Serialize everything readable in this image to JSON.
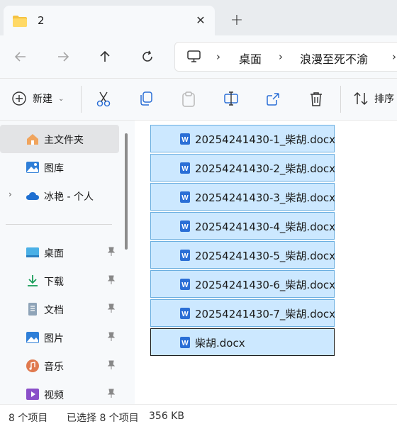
{
  "tab": {
    "title": "2",
    "icon": "folder-icon"
  },
  "address": {
    "icon": "this-pc-icon",
    "crumbs": [
      "桌面",
      "浪漫至死不渝"
    ]
  },
  "toolbar": {
    "new_label": "新建",
    "sort_label": "排序"
  },
  "sidebar": {
    "items": [
      {
        "label": "主文件夹",
        "icon": "home-icon",
        "selected": true
      },
      {
        "label": "图库",
        "icon": "gallery-icon"
      },
      {
        "label": "冰艳 - 个人",
        "icon": "onedrive-cloud-icon"
      },
      {
        "label": "桌面",
        "icon": "desktop-icon",
        "pinned": true
      },
      {
        "label": "下载",
        "icon": "download-icon",
        "pinned": true
      },
      {
        "label": "文档",
        "icon": "documents-icon",
        "pinned": true
      },
      {
        "label": "图片",
        "icon": "pictures-icon",
        "pinned": true
      },
      {
        "label": "音乐",
        "icon": "music-icon",
        "pinned": true
      },
      {
        "label": "视频",
        "icon": "videos-icon",
        "pinned": true
      }
    ]
  },
  "files": [
    {
      "name": "20254241430-1_柴胡.docx"
    },
    {
      "name": "20254241430-2_柴胡.docx"
    },
    {
      "name": "20254241430-3_柴胡.docx"
    },
    {
      "name": "20254241430-4_柴胡.docx"
    },
    {
      "name": "20254241430-5_柴胡.docx"
    },
    {
      "name": "20254241430-6_柴胡.docx"
    },
    {
      "name": "20254241430-7_柴胡.docx"
    },
    {
      "name": "柴胡.docx"
    }
  ],
  "status": {
    "item_count": "8 个项目",
    "selection": "已选择 8 个项目",
    "size": "356 KB"
  },
  "colors": {
    "selection_fill": "#cce8ff",
    "selection_border": "#6aaee0",
    "word_blue": "#2b6fd6",
    "folder_yellow": "#f5c242"
  }
}
